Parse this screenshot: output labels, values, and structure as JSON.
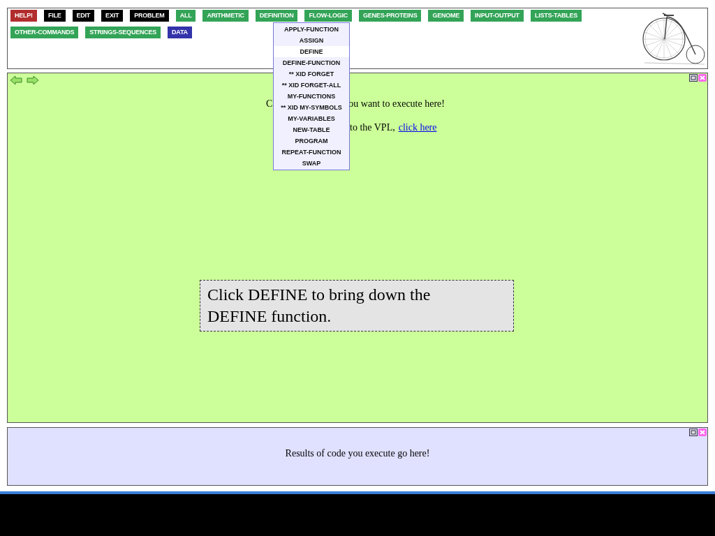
{
  "toolbar": [
    {
      "label": "HELP!",
      "color": "#b22d2d"
    },
    {
      "label": "FILE",
      "color": "#000000"
    },
    {
      "label": "EDIT",
      "color": "#000000"
    },
    {
      "label": "EXIT",
      "color": "#000000"
    },
    {
      "label": "PROBLEM",
      "color": "#000000"
    },
    {
      "label": "ALL",
      "color": "#33a457"
    },
    {
      "label": "ARITHMETIC",
      "color": "#33a457"
    },
    {
      "label": "DEFINITION",
      "color": "#33a457"
    },
    {
      "label": "FLOW-LOGIC",
      "color": "#33a457"
    },
    {
      "label": "GENES-PROTEINS",
      "color": "#33a457"
    },
    {
      "label": "GENOME",
      "color": "#33a457"
    },
    {
      "label": "INPUT-OUTPUT",
      "color": "#33a457"
    },
    {
      "label": "LISTS-TABLES",
      "color": "#33a457"
    },
    {
      "label": "OTHER-COMMANDS",
      "color": "#33a457"
    },
    {
      "label": "STRINGS-SEQUENCES",
      "color": "#33a457"
    },
    {
      "label": "DATA",
      "color": "#3333aa"
    }
  ],
  "dropdown": {
    "items": [
      {
        "label": "APPLY-FUNCTION",
        "selected": false
      },
      {
        "label": "ASSIGN",
        "selected": false
      },
      {
        "label": "DEFINE",
        "selected": true
      },
      {
        "label": "DEFINE-FUNCTION",
        "selected": false
      },
      {
        "label": "** XID FORGET",
        "selected": false
      },
      {
        "label": "** XID FORGET-ALL",
        "selected": false
      },
      {
        "label": "MY-FUNCTIONS",
        "selected": false
      },
      {
        "label": "** XID MY-SYMBOLS",
        "selected": false
      },
      {
        "label": "MY-VARIABLES",
        "selected": false
      },
      {
        "label": "NEW-TABLE",
        "selected": false
      },
      {
        "label": "PROGRAM",
        "selected": false
      },
      {
        "label": "REPEAT-FUNCTION",
        "selected": false
      },
      {
        "label": "SWAP",
        "selected": false
      }
    ]
  },
  "code_panel": {
    "line_1_start": "C",
    "line_1_end": "ou want to execute here!",
    "line_2": "to the VPL,",
    "link": "click here"
  },
  "hint": "Click DEFINE to bring down the DEFINE function.",
  "results_panel": {
    "text": "Results of code you execute go here!"
  }
}
